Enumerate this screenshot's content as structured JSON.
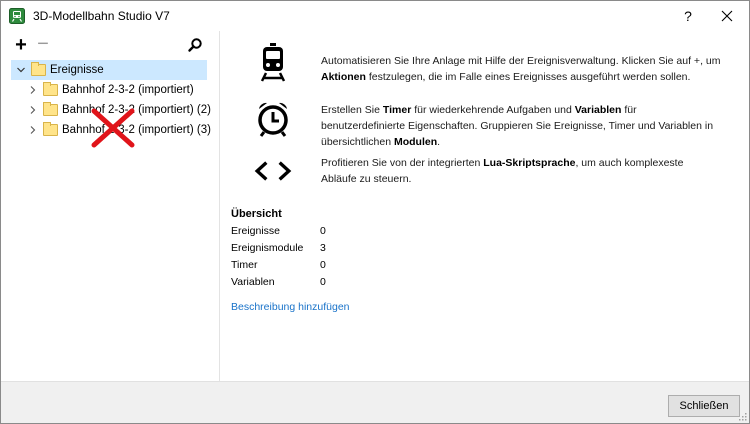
{
  "window": {
    "title": "3D-Modellbahn Studio V7",
    "help_label": "?"
  },
  "left_toolbar": {
    "add_label": "+",
    "remove_label": "−"
  },
  "tree": {
    "root": {
      "label": "Ereignisse",
      "expanded": true,
      "selected": true
    },
    "items": [
      {
        "label": "Bahnhof 2-3-2 (importiert)"
      },
      {
        "label": "Bahnhof 2-3-2 (importiert) (2)"
      },
      {
        "label": "Bahnhof 2-3-2 (importiert) (3)"
      }
    ]
  },
  "features": [
    {
      "icon": "train-icon",
      "pre": "Automatisieren Sie Ihre Anlage mit Hilfe der Ereignisverwaltung. Klicken Sie auf +, um ",
      "bold1": "Aktionen",
      "mid": " festzulegen, die im Falle eines Ereignisses ausgeführt werden sollen.",
      "bold2": "",
      "post": "",
      "bold3": "",
      "end": ""
    },
    {
      "icon": "alarm-clock-icon",
      "pre": "Erstellen Sie ",
      "bold1": "Timer",
      "mid": " für wiederkehrende Aufgaben und ",
      "bold2": "Variablen",
      "post": " für benutzerdefinierte Eigenschaften. Gruppieren Sie Ereignisse, Timer und Variablen in übersichtlichen ",
      "bold3": "Modulen",
      "end": "."
    },
    {
      "icon": "code-brackets-icon",
      "pre": "Profitieren Sie von der integrierten ",
      "bold1": "Lua-Skriptsprache",
      "mid": ", um auch komplexeste Abläufe zu steuern.",
      "bold2": "",
      "post": "",
      "bold3": "",
      "end": ""
    }
  ],
  "overview": {
    "title": "Übersicht",
    "rows": [
      {
        "label": "Ereignisse",
        "value": "0"
      },
      {
        "label": "Ereignismodule",
        "value": "3"
      },
      {
        "label": "Timer",
        "value": "0"
      },
      {
        "label": "Variablen",
        "value": "0"
      }
    ]
  },
  "add_description_link": "Beschreibung hinzufügen",
  "footer": {
    "close_label": "Schließen"
  },
  "colors": {
    "selection": "#cce8ff",
    "link": "#1a73c9",
    "annotation_x": "#e0141a"
  }
}
